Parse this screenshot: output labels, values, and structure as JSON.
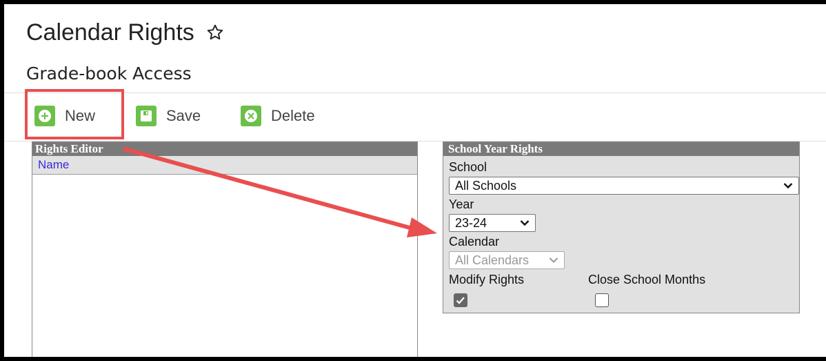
{
  "page": {
    "title": "Calendar Rights",
    "subtitle": "Grade-book Access"
  },
  "toolbar": {
    "new_label": "New",
    "save_label": "Save",
    "delete_label": "Delete"
  },
  "rights_editor": {
    "header": "Rights Editor",
    "column_name": "Name"
  },
  "school_year_rights": {
    "header": "School Year Rights",
    "school_label": "School",
    "school_value": "All Schools",
    "year_label": "Year",
    "year_value": "23-24",
    "calendar_label": "Calendar",
    "calendar_value": "All Calendars",
    "modify_rights_label": "Modify Rights",
    "modify_rights_checked": true,
    "close_months_label": "Close School Months",
    "close_months_checked": false
  },
  "icons": {
    "favorite": "star-outline-icon",
    "new": "plus-circle-icon",
    "save": "floppy-disk-icon",
    "delete": "x-circle-icon"
  },
  "colors": {
    "accent_green": "#6cc04a",
    "annotation_red": "#e94f4f",
    "panel_header": "#7a7a7a",
    "link_blue": "#3a2bd6"
  }
}
